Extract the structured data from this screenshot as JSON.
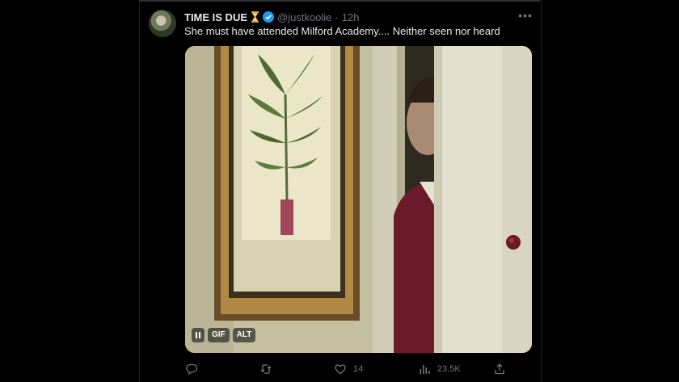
{
  "tweet": {
    "display_name": "TIME IS DUE",
    "name_emoji": "hourglass-icon",
    "handle": "@justkoolie",
    "separator": "·",
    "time": "12h",
    "text": "She must have attended Milford Academy.... Neither seen nor heard",
    "verified": true
  },
  "media": {
    "type": "GIF",
    "chips": {
      "gif": "GIF",
      "alt": "ALT"
    },
    "playing": true
  },
  "actions": {
    "reply_count": "",
    "retweet_count": "",
    "like_count": "14",
    "views_count": "23.5K"
  },
  "colors": {
    "background": "#000000",
    "text": "#e7e9ea",
    "muted": "#71767b",
    "verified": "#1d9bf0"
  }
}
